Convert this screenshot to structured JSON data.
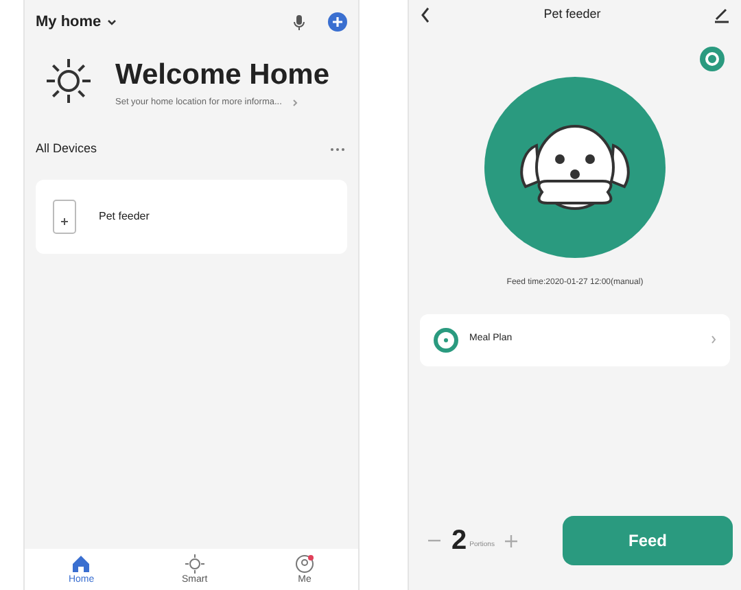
{
  "home_screen": {
    "home_selector": "My home",
    "welcome_title": "Welcome Home",
    "welcome_subtitle": "Set your home location for more informa...",
    "section_title": "All Devices",
    "devices": [
      {
        "name": "Pet feeder"
      }
    ],
    "bottom_nav": [
      {
        "label": "Home",
        "selected": true
      },
      {
        "label": "Smart",
        "selected": false
      },
      {
        "label": "Me",
        "selected": false
      }
    ]
  },
  "feeder_screen": {
    "title": "Pet feeder",
    "feed_time": "Feed time:2020-01-27 12:00(manual)",
    "meal_plan": "Meal Plan",
    "portions": {
      "value": "2",
      "unit": "Portions"
    },
    "feed_button": "Feed"
  }
}
